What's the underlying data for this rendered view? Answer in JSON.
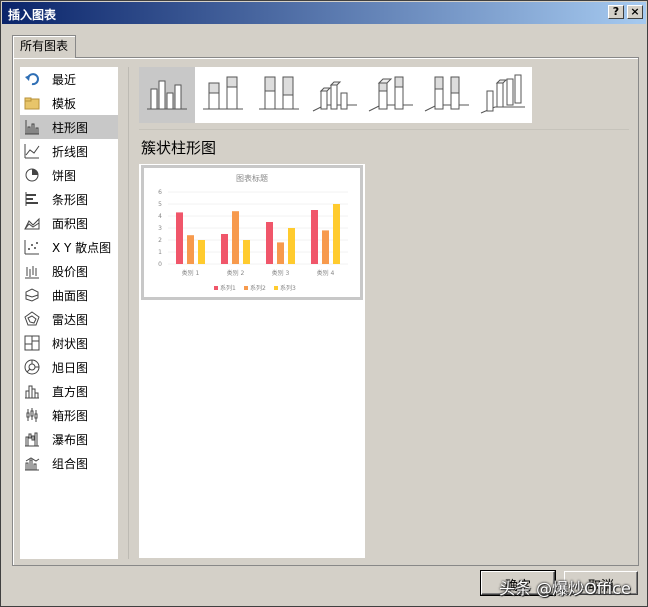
{
  "window": {
    "title": "插入图表",
    "help_button": "?",
    "close_button": "×"
  },
  "tab": {
    "label": "所有图表"
  },
  "sidebar": {
    "items": [
      {
        "label": "最近",
        "icon": "recent-icon"
      },
      {
        "label": "模板",
        "icon": "folder-icon"
      },
      {
        "label": "柱形图",
        "icon": "column-chart-icon",
        "selected": true
      },
      {
        "label": "折线图",
        "icon": "line-chart-icon"
      },
      {
        "label": "饼图",
        "icon": "pie-chart-icon"
      },
      {
        "label": "条形图",
        "icon": "bar-chart-icon"
      },
      {
        "label": "面积图",
        "icon": "area-chart-icon"
      },
      {
        "label": "X Y 散点图",
        "icon": "scatter-chart-icon"
      },
      {
        "label": "股价图",
        "icon": "stock-chart-icon"
      },
      {
        "label": "曲面图",
        "icon": "surface-chart-icon"
      },
      {
        "label": "雷达图",
        "icon": "radar-chart-icon"
      },
      {
        "label": "树状图",
        "icon": "treemap-chart-icon"
      },
      {
        "label": "旭日图",
        "icon": "sunburst-chart-icon"
      },
      {
        "label": "直方图",
        "icon": "histogram-chart-icon"
      },
      {
        "label": "箱形图",
        "icon": "box-whisker-chart-icon"
      },
      {
        "label": "瀑布图",
        "icon": "waterfall-chart-icon"
      },
      {
        "label": "组合图",
        "icon": "combo-chart-icon"
      }
    ]
  },
  "subtypes": [
    {
      "icon": "clustered-column-icon",
      "selected": true
    },
    {
      "icon": "stacked-column-icon"
    },
    {
      "icon": "100-stacked-column-icon"
    },
    {
      "icon": "3d-clustered-column-icon"
    },
    {
      "icon": "3d-stacked-column-icon"
    },
    {
      "icon": "3d-100-stacked-column-icon"
    },
    {
      "icon": "3d-column-icon"
    }
  ],
  "selected_subtype_title": "簇状柱形图",
  "chart_data": {
    "type": "bar",
    "title": "图表标题",
    "categories": [
      "类别 1",
      "类别 2",
      "类别 3",
      "类别 4"
    ],
    "series": [
      {
        "name": "系列1",
        "values": [
          4.3,
          2.5,
          3.5,
          4.5
        ],
        "color": "#f0566a"
      },
      {
        "name": "系列2",
        "values": [
          2.4,
          4.4,
          1.8,
          2.8
        ],
        "color": "#f79a4d"
      },
      {
        "name": "系列3",
        "values": [
          2,
          2,
          3,
          5
        ],
        "color": "#ffcb2e"
      }
    ],
    "yticks": [
      "0",
      "1",
      "2",
      "3",
      "4",
      "5",
      "6"
    ],
    "ylim": [
      0,
      6
    ],
    "legend": "bottom",
    "grid": true
  },
  "buttons": {
    "ok": "确定",
    "cancel": "取消"
  },
  "watermark": "头条 @爆炒Office"
}
